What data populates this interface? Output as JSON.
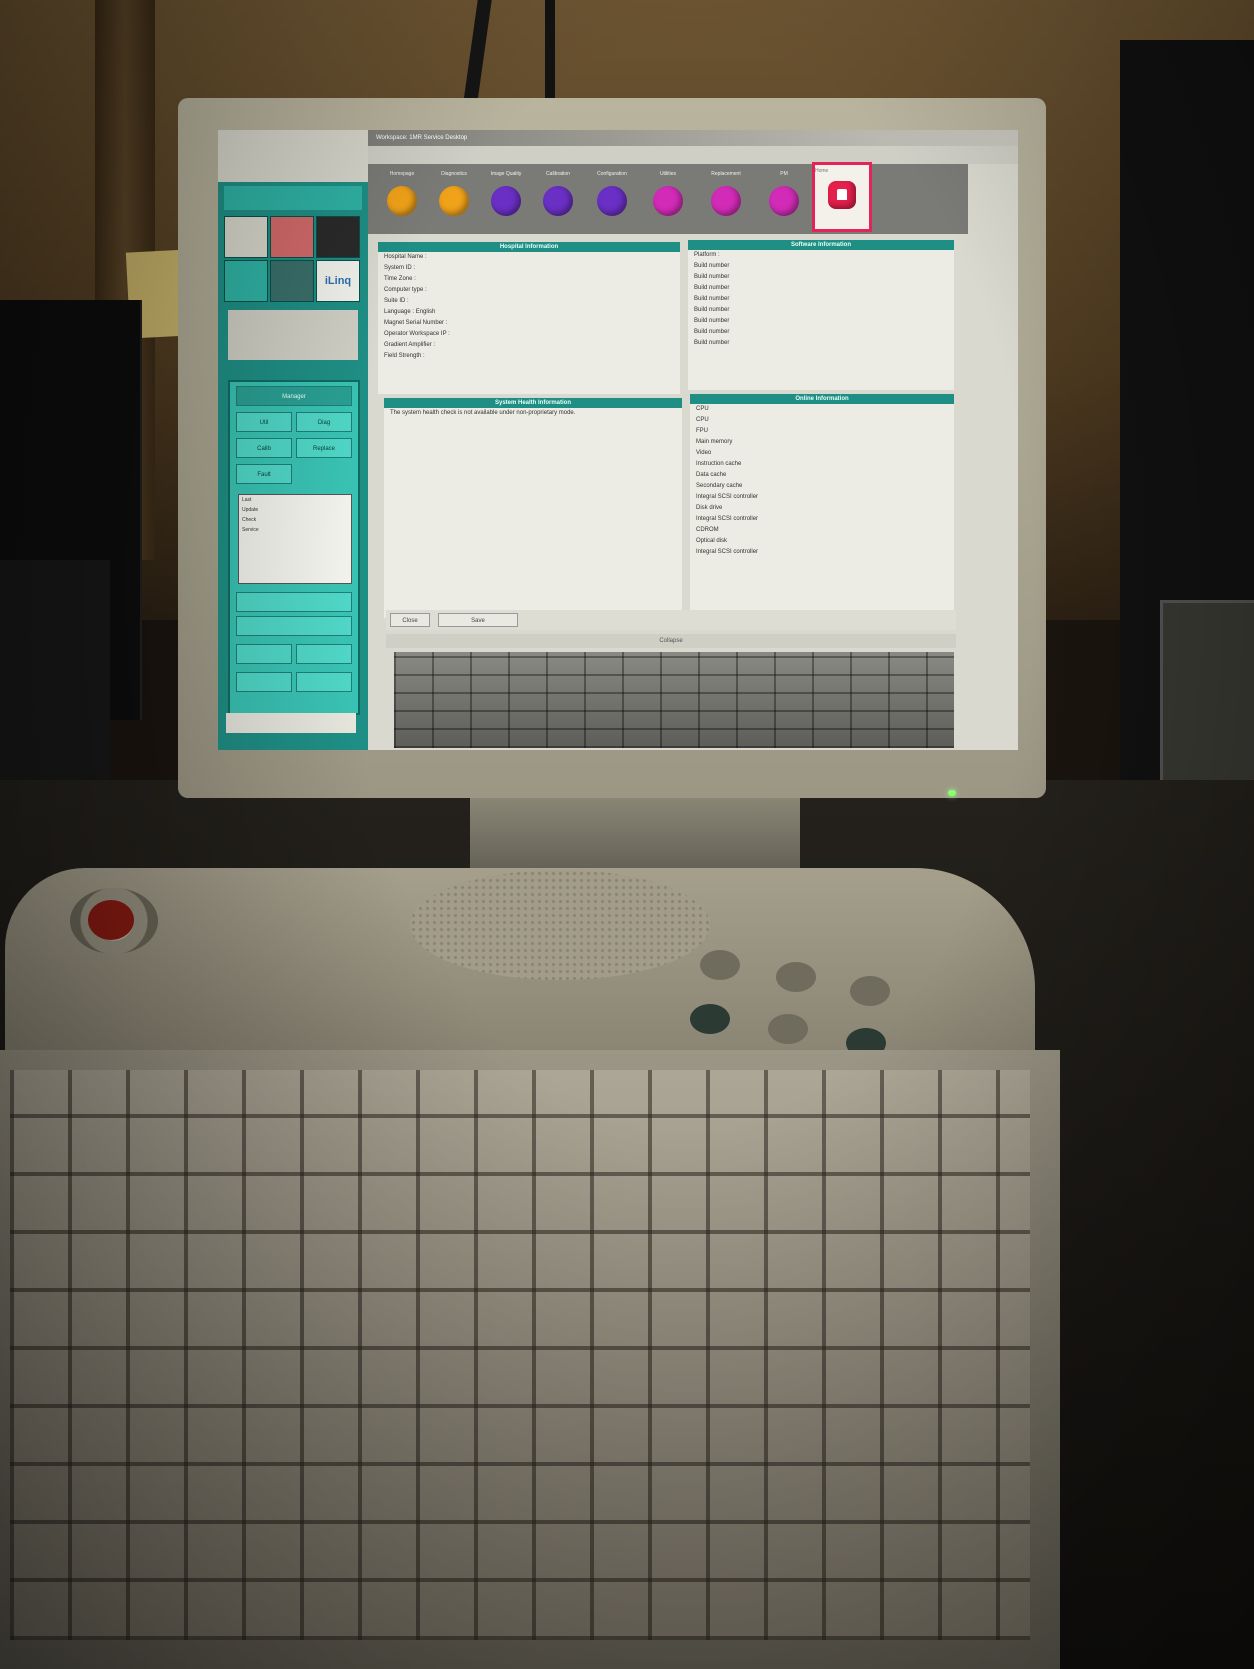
{
  "screen": {
    "window_title": "Workspace: 1MR Service Desktop",
    "left_panel": {
      "tile_label": "iLinq",
      "manager_buttons": [
        "Manager",
        "Util",
        "Diag",
        "Calib",
        "Replace",
        "Fault"
      ],
      "status_lines": [
        "Last",
        "Update",
        "Check",
        "Service"
      ],
      "bottom_label": ""
    },
    "nav": [
      {
        "label": "Homepage",
        "color": "#f0a21a"
      },
      {
        "label": "Diagnostics",
        "color": "#f0a21a"
      },
      {
        "label": "Image Quality",
        "color": "#6a2fc4"
      },
      {
        "label": "Calibration",
        "color": "#6a2fc4"
      },
      {
        "label": "Configuration",
        "color": "#6a2fc4"
      },
      {
        "label": "Utilities",
        "color": "#d12bb7"
      },
      {
        "label": "Replacement",
        "color": "#d12bb7"
      },
      {
        "label": "PM",
        "color": "#d12bb7"
      },
      {
        "label": "Home",
        "color": "#e4204c"
      }
    ],
    "hospital": {
      "title": "Hospital Information",
      "lines": [
        "Hospital Name :",
        "System ID :",
        "Time Zone :",
        "Computer type :",
        "Suite ID :",
        "Language :  English",
        "Magnet Serial Number :",
        "Operator Workspace IP :",
        "Gradient Amplifier :",
        "Field Strength :"
      ]
    },
    "software": {
      "title": "Software Information",
      "lines": [
        "Platform :",
        "Build number",
        "Build number",
        "Build number",
        "Build number",
        "Build number",
        "Build number",
        "Build number",
        "Build number"
      ],
      "warning": ""
    },
    "health": {
      "title": "System Health Information",
      "lines": [
        "The system health check is not available under non-proprietary mode."
      ]
    },
    "online": {
      "title": "Online Information",
      "lines": [
        "CPU",
        "CPU",
        "FPU",
        "Main memory",
        "Video",
        "Instruction cache",
        "Data cache",
        "Secondary cache",
        "Integral SCSI controller",
        "Disk drive",
        "Integral SCSI controller",
        "CDROM",
        "Optical disk",
        "Integral SCSI controller"
      ]
    },
    "buttons": [
      "Close",
      "Save"
    ],
    "collapse_label": "Collapse"
  }
}
